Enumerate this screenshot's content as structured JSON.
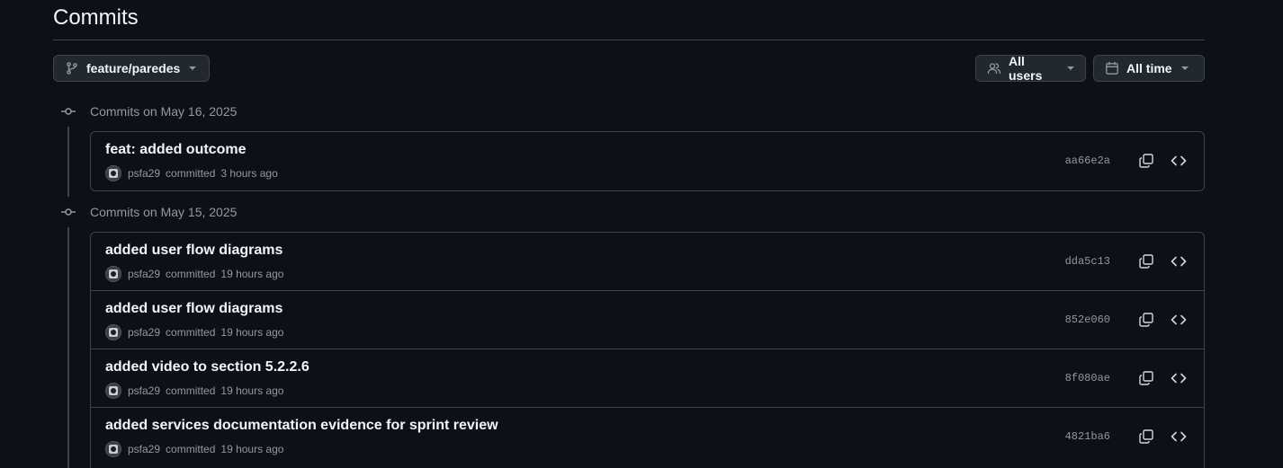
{
  "page": {
    "title": "Commits"
  },
  "filters": {
    "branch": "feature/paredes",
    "users": "All users",
    "time": "All time"
  },
  "groups": [
    {
      "label": "Commits on May 16, 2025",
      "commits": [
        {
          "title": "feat: added outcome",
          "author": "psfa29",
          "verb": "committed",
          "time": "3 hours ago",
          "sha": "aa66e2a"
        }
      ]
    },
    {
      "label": "Commits on May 15, 2025",
      "commits": [
        {
          "title": "added user flow diagrams",
          "author": "psfa29",
          "verb": "committed",
          "time": "19 hours ago",
          "sha": "dda5c13"
        },
        {
          "title": "added user flow diagrams",
          "author": "psfa29",
          "verb": "committed",
          "time": "19 hours ago",
          "sha": "852e060"
        },
        {
          "title": "added video to section 5.2.2.6",
          "author": "psfa29",
          "verb": "committed",
          "time": "19 hours ago",
          "sha": "8f080ae"
        },
        {
          "title": "added services documentation evidence for sprint review",
          "author": "psfa29",
          "verb": "committed",
          "time": "19 hours ago",
          "sha": "4821ba6"
        }
      ]
    }
  ],
  "icons": {
    "branch": "git-branch-icon",
    "users": "people-icon",
    "time": "calendar-icon",
    "commit_node": "git-commit-icon",
    "copy": "copy-icon",
    "browse": "code-icon"
  },
  "colors": {
    "background": "#0d1117",
    "border": "#3d444d",
    "button_bg": "#212830",
    "text_primary": "#f0f6fc",
    "text_muted": "#9198a1"
  }
}
